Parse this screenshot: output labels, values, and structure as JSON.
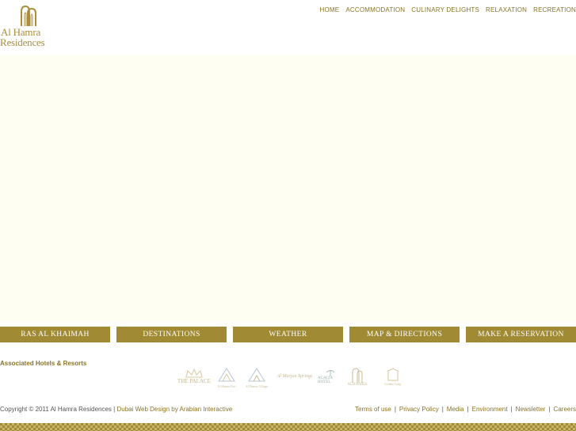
{
  "brand": {
    "line1": "Al Hamra",
    "line2": "Residences",
    "color": "#a98f3c"
  },
  "topnav": [
    "HOME",
    "ACCOMMODATION",
    "CULINARY DELIGHTS",
    "RELAXATION",
    "RECREATION"
  ],
  "buttons": [
    "RAS AL KHAIMAH",
    "DESTINATIONS",
    "WEATHER",
    "MAP & DIRECTIONS",
    "MAKE A RESERVATION"
  ],
  "associated": {
    "title": "Associated Hotels & Resorts",
    "partners": [
      "THE PALACE",
      "Al Hamra Fort",
      "Al Hamra Village",
      "Al Murjan Springs",
      "ACACIA HOTEL",
      "ALHAMRA",
      "Golden Tulip"
    ]
  },
  "footer": {
    "copyright": "Copyright © 2011 Al Hamra Residences |",
    "design_link": "Dubai Web Design by Arabian Interactive",
    "links": [
      "Terms of use",
      "Privacy Policy",
      "Media",
      "Environment",
      "Newsletter",
      "Careers"
    ]
  },
  "colors": {
    "accent": "#a08a33",
    "hero_bg": "#fefef3",
    "nav_text": "#8a7425"
  }
}
